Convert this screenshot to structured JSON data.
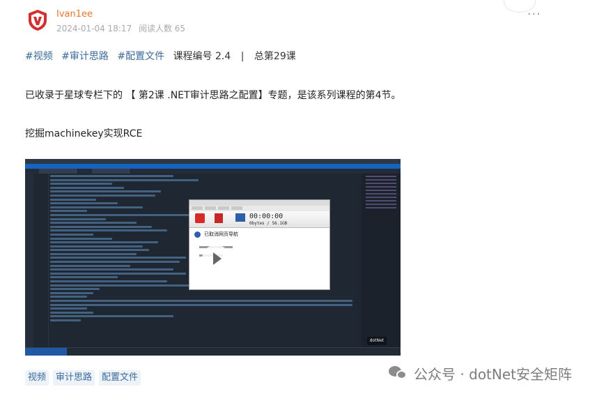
{
  "author": {
    "name": "Ivan1ee",
    "date": "2024-01-04 18:17",
    "read_label": "阅读人数 65"
  },
  "tagline": {
    "tags": [
      "#视频",
      "#审计思路",
      "#配置文件"
    ],
    "course": "课程编号 2.4",
    "total": "总第29课"
  },
  "intro": "已收录于星球专栏下的 【 第2课 .NET审计思路之配置】专题，是该系列课程的第4节。",
  "topic": "挖掘machinekey实现RCE",
  "video": {
    "recorder": {
      "time": "00:00:00",
      "bytes": "0bytes / 56.1GB",
      "message": "已取消网页导航"
    }
  },
  "chips": [
    "视频",
    "审计思路",
    "配置文件"
  ],
  "watermark": "公众号 · dotNet安全矩阵",
  "colors": {
    "author": "#e8772e",
    "tag": "#3b6b9c",
    "logo_red": "#d32f2f"
  },
  "icons": {
    "more": "more-dots-icon",
    "play": "play-icon",
    "logo": "shield-logo-icon"
  }
}
